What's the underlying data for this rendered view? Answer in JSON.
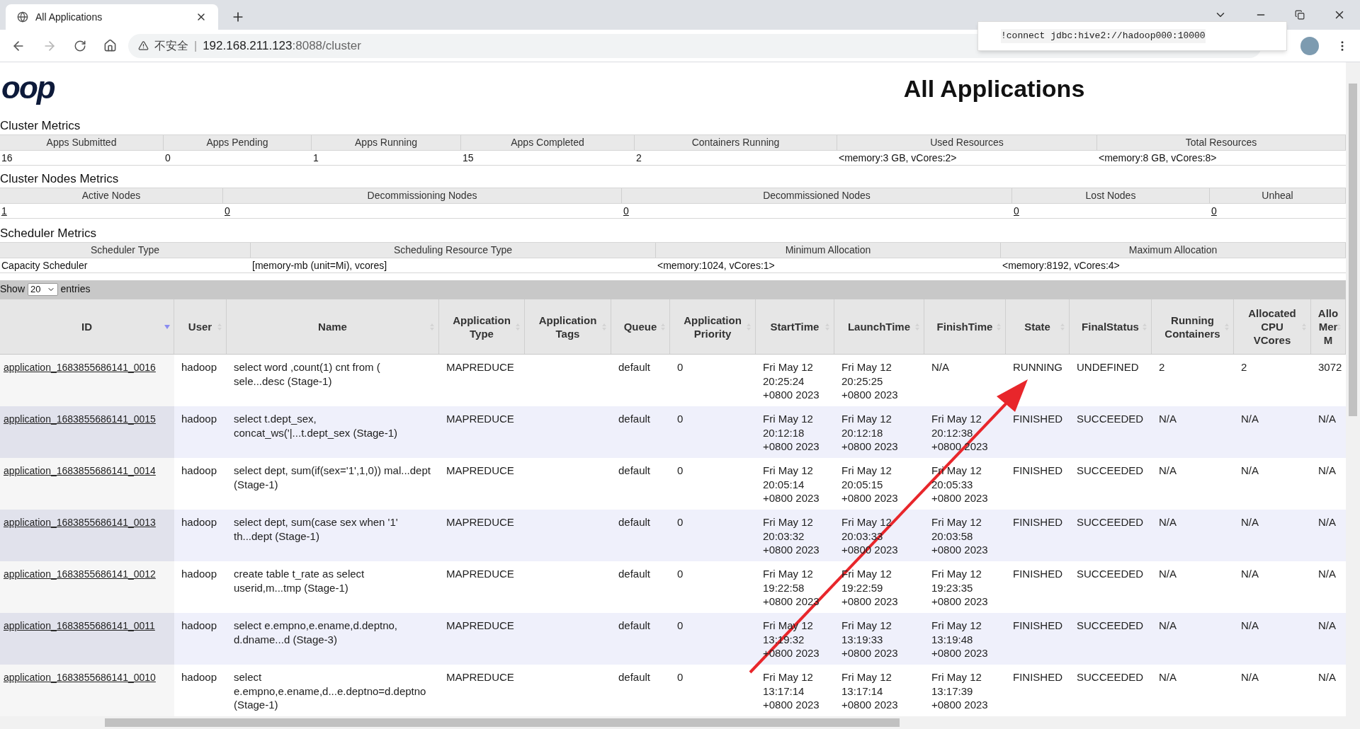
{
  "browser": {
    "tab_title": "All Applications",
    "url_warning": "不安全",
    "url_separator": "|",
    "url_host": "192.168.211.123",
    "url_path": ":8088/cluster",
    "popup_text": "!connect jdbc:hive2://hadoop000:10000"
  },
  "page": {
    "logo_text": "oop",
    "title": "All Applications"
  },
  "cluster_metrics": {
    "title": "Cluster Metrics",
    "columns": [
      "Apps Submitted",
      "Apps Pending",
      "Apps Running",
      "Apps Completed",
      "Containers Running",
      "Used Resources",
      "Total Resources"
    ],
    "values": [
      "16",
      "0",
      "1",
      "15",
      "2",
      "<memory:3 GB, vCores:2>",
      "<memory:8 GB, vCores:8>"
    ]
  },
  "nodes_metrics": {
    "title": "Cluster Nodes Metrics",
    "columns": [
      "Active Nodes",
      "Decommissioning Nodes",
      "Decommissioned Nodes",
      "Lost Nodes",
      "Unheal"
    ],
    "values": [
      "1",
      "0",
      "0",
      "0",
      "0"
    ]
  },
  "scheduler_metrics": {
    "title": "Scheduler Metrics",
    "columns": [
      "Scheduler Type",
      "Scheduling Resource Type",
      "Minimum Allocation",
      "Maximum Allocation"
    ],
    "values": [
      "Capacity Scheduler",
      "[memory-mb (unit=Mi), vcores]",
      "<memory:1024, vCores:1>",
      "<memory:8192, vCores:4>"
    ]
  },
  "show_entries": {
    "prefix": "Show",
    "value": "20",
    "suffix": "entries"
  },
  "apps": {
    "columns": [
      {
        "label": "ID",
        "sorted": true
      },
      {
        "label": "User",
        "sorted": false
      },
      {
        "label": "Name",
        "sorted": false
      },
      {
        "label": "Application Type",
        "sorted": false
      },
      {
        "label": "Application Tags",
        "sorted": false
      },
      {
        "label": "Queue",
        "sorted": false
      },
      {
        "label": "Application Priority",
        "sorted": false
      },
      {
        "label": "StartTime",
        "sorted": false
      },
      {
        "label": "LaunchTime",
        "sorted": false
      },
      {
        "label": "FinishTime",
        "sorted": false
      },
      {
        "label": "State",
        "sorted": false
      },
      {
        "label": "FinalStatus",
        "sorted": false
      },
      {
        "label": "Running Containers",
        "sorted": false
      },
      {
        "label": "Allocated CPU VCores",
        "sorted": false
      },
      {
        "label": "Allo Mer M",
        "sorted": false
      }
    ],
    "rows": [
      {
        "cells": [
          "application_1683855686141_0016",
          "hadoop",
          "select word ,count(1) cnt from ( sele...desc (Stage-1)",
          "MAPREDUCE",
          "",
          "default",
          "0",
          "Fri May 12 20:25:24 +0800 2023",
          "Fri May 12 20:25:25 +0800 2023",
          "N/A",
          "RUNNING",
          "UNDEFINED",
          "2",
          "2",
          "3072"
        ]
      },
      {
        "cells": [
          "application_1683855686141_0015",
          "hadoop",
          "select t.dept_sex, concat_ws('|...t.dept_sex (Stage-1)",
          "MAPREDUCE",
          "",
          "default",
          "0",
          "Fri May 12 20:12:18 +0800 2023",
          "Fri May 12 20:12:18 +0800 2023",
          "Fri May 12 20:12:38 +0800 2023",
          "FINISHED",
          "SUCCEEDED",
          "N/A",
          "N/A",
          "N/A"
        ]
      },
      {
        "cells": [
          "application_1683855686141_0014",
          "hadoop",
          "select dept, sum(if(sex='1',1,0)) mal...dept (Stage-1)",
          "MAPREDUCE",
          "",
          "default",
          "0",
          "Fri May 12 20:05:14 +0800 2023",
          "Fri May 12 20:05:15 +0800 2023",
          "Fri May 12 20:05:33 +0800 2023",
          "FINISHED",
          "SUCCEEDED",
          "N/A",
          "N/A",
          "N/A"
        ]
      },
      {
        "cells": [
          "application_1683855686141_0013",
          "hadoop",
          "select dept, sum(case sex when '1' th...dept (Stage-1)",
          "MAPREDUCE",
          "",
          "default",
          "0",
          "Fri May 12 20:03:32 +0800 2023",
          "Fri May 12 20:03:33 +0800 2023",
          "Fri May 12 20:03:58 +0800 2023",
          "FINISHED",
          "SUCCEEDED",
          "N/A",
          "N/A",
          "N/A"
        ]
      },
      {
        "cells": [
          "application_1683855686141_0012",
          "hadoop",
          "create table t_rate as select userid,m...tmp (Stage-1)",
          "MAPREDUCE",
          "",
          "default",
          "0",
          "Fri May 12 19:22:58 +0800 2023",
          "Fri May 12 19:22:59 +0800 2023",
          "Fri May 12 19:23:35 +0800 2023",
          "FINISHED",
          "SUCCEEDED",
          "N/A",
          "N/A",
          "N/A"
        ]
      },
      {
        "cells": [
          "application_1683855686141_0011",
          "hadoop",
          "select e.empno,e.ename,d.deptno, d.dname...d (Stage-3)",
          "MAPREDUCE",
          "",
          "default",
          "0",
          "Fri May 12 13:19:32 +0800 2023",
          "Fri May 12 13:19:33 +0800 2023",
          "Fri May 12 13:19:48 +0800 2023",
          "FINISHED",
          "SUCCEEDED",
          "N/A",
          "N/A",
          "N/A"
        ]
      },
      {
        "cells": [
          "application_1683855686141_0010",
          "hadoop",
          "select e.empno,e.ename,d...e.deptno=d.deptno (Stage-1)",
          "MAPREDUCE",
          "",
          "default",
          "0",
          "Fri May 12 13:17:14 +0800 2023",
          "Fri May 12 13:17:14 +0800 2023",
          "Fri May 12 13:17:39 +0800 2023",
          "FINISHED",
          "SUCCEEDED",
          "N/A",
          "N/A",
          "N/A"
        ]
      }
    ]
  }
}
